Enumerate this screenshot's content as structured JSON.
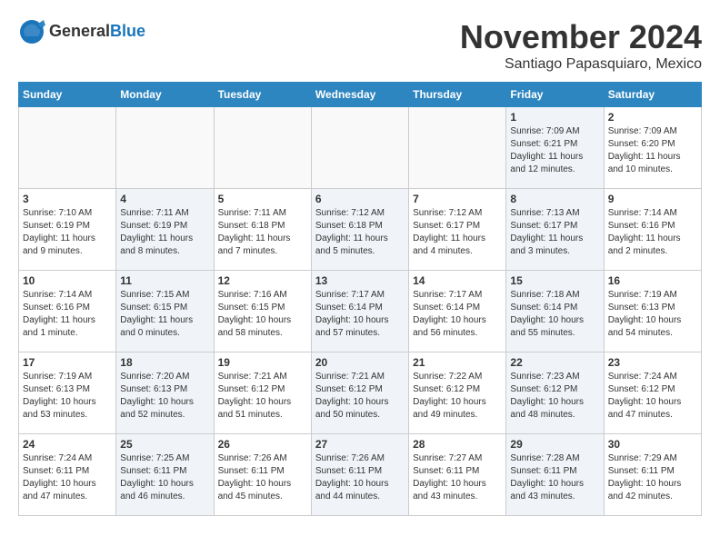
{
  "header": {
    "logo_general": "General",
    "logo_blue": "Blue",
    "month": "November 2024",
    "location": "Santiago Papasquiaro, Mexico"
  },
  "days_of_week": [
    "Sunday",
    "Monday",
    "Tuesday",
    "Wednesday",
    "Thursday",
    "Friday",
    "Saturday"
  ],
  "weeks": [
    [
      {
        "day": "",
        "info": "",
        "shaded": false
      },
      {
        "day": "",
        "info": "",
        "shaded": false
      },
      {
        "day": "",
        "info": "",
        "shaded": false
      },
      {
        "day": "",
        "info": "",
        "shaded": false
      },
      {
        "day": "",
        "info": "",
        "shaded": false
      },
      {
        "day": "1",
        "info": "Sunrise: 7:09 AM\nSunset: 6:21 PM\nDaylight: 11 hours and 12 minutes.",
        "shaded": true
      },
      {
        "day": "2",
        "info": "Sunrise: 7:09 AM\nSunset: 6:20 PM\nDaylight: 11 hours and 10 minutes.",
        "shaded": false
      }
    ],
    [
      {
        "day": "3",
        "info": "Sunrise: 7:10 AM\nSunset: 6:19 PM\nDaylight: 11 hours and 9 minutes.",
        "shaded": false
      },
      {
        "day": "4",
        "info": "Sunrise: 7:11 AM\nSunset: 6:19 PM\nDaylight: 11 hours and 8 minutes.",
        "shaded": true
      },
      {
        "day": "5",
        "info": "Sunrise: 7:11 AM\nSunset: 6:18 PM\nDaylight: 11 hours and 7 minutes.",
        "shaded": false
      },
      {
        "day": "6",
        "info": "Sunrise: 7:12 AM\nSunset: 6:18 PM\nDaylight: 11 hours and 5 minutes.",
        "shaded": true
      },
      {
        "day": "7",
        "info": "Sunrise: 7:12 AM\nSunset: 6:17 PM\nDaylight: 11 hours and 4 minutes.",
        "shaded": false
      },
      {
        "day": "8",
        "info": "Sunrise: 7:13 AM\nSunset: 6:17 PM\nDaylight: 11 hours and 3 minutes.",
        "shaded": true
      },
      {
        "day": "9",
        "info": "Sunrise: 7:14 AM\nSunset: 6:16 PM\nDaylight: 11 hours and 2 minutes.",
        "shaded": false
      }
    ],
    [
      {
        "day": "10",
        "info": "Sunrise: 7:14 AM\nSunset: 6:16 PM\nDaylight: 11 hours and 1 minute.",
        "shaded": false
      },
      {
        "day": "11",
        "info": "Sunrise: 7:15 AM\nSunset: 6:15 PM\nDaylight: 11 hours and 0 minutes.",
        "shaded": true
      },
      {
        "day": "12",
        "info": "Sunrise: 7:16 AM\nSunset: 6:15 PM\nDaylight: 10 hours and 58 minutes.",
        "shaded": false
      },
      {
        "day": "13",
        "info": "Sunrise: 7:17 AM\nSunset: 6:14 PM\nDaylight: 10 hours and 57 minutes.",
        "shaded": true
      },
      {
        "day": "14",
        "info": "Sunrise: 7:17 AM\nSunset: 6:14 PM\nDaylight: 10 hours and 56 minutes.",
        "shaded": false
      },
      {
        "day": "15",
        "info": "Sunrise: 7:18 AM\nSunset: 6:14 PM\nDaylight: 10 hours and 55 minutes.",
        "shaded": true
      },
      {
        "day": "16",
        "info": "Sunrise: 7:19 AM\nSunset: 6:13 PM\nDaylight: 10 hours and 54 minutes.",
        "shaded": false
      }
    ],
    [
      {
        "day": "17",
        "info": "Sunrise: 7:19 AM\nSunset: 6:13 PM\nDaylight: 10 hours and 53 minutes.",
        "shaded": false
      },
      {
        "day": "18",
        "info": "Sunrise: 7:20 AM\nSunset: 6:13 PM\nDaylight: 10 hours and 52 minutes.",
        "shaded": true
      },
      {
        "day": "19",
        "info": "Sunrise: 7:21 AM\nSunset: 6:12 PM\nDaylight: 10 hours and 51 minutes.",
        "shaded": false
      },
      {
        "day": "20",
        "info": "Sunrise: 7:21 AM\nSunset: 6:12 PM\nDaylight: 10 hours and 50 minutes.",
        "shaded": true
      },
      {
        "day": "21",
        "info": "Sunrise: 7:22 AM\nSunset: 6:12 PM\nDaylight: 10 hours and 49 minutes.",
        "shaded": false
      },
      {
        "day": "22",
        "info": "Sunrise: 7:23 AM\nSunset: 6:12 PM\nDaylight: 10 hours and 48 minutes.",
        "shaded": true
      },
      {
        "day": "23",
        "info": "Sunrise: 7:24 AM\nSunset: 6:12 PM\nDaylight: 10 hours and 47 minutes.",
        "shaded": false
      }
    ],
    [
      {
        "day": "24",
        "info": "Sunrise: 7:24 AM\nSunset: 6:11 PM\nDaylight: 10 hours and 47 minutes.",
        "shaded": false
      },
      {
        "day": "25",
        "info": "Sunrise: 7:25 AM\nSunset: 6:11 PM\nDaylight: 10 hours and 46 minutes.",
        "shaded": true
      },
      {
        "day": "26",
        "info": "Sunrise: 7:26 AM\nSunset: 6:11 PM\nDaylight: 10 hours and 45 minutes.",
        "shaded": false
      },
      {
        "day": "27",
        "info": "Sunrise: 7:26 AM\nSunset: 6:11 PM\nDaylight: 10 hours and 44 minutes.",
        "shaded": true
      },
      {
        "day": "28",
        "info": "Sunrise: 7:27 AM\nSunset: 6:11 PM\nDaylight: 10 hours and 43 minutes.",
        "shaded": false
      },
      {
        "day": "29",
        "info": "Sunrise: 7:28 AM\nSunset: 6:11 PM\nDaylight: 10 hours and 43 minutes.",
        "shaded": true
      },
      {
        "day": "30",
        "info": "Sunrise: 7:29 AM\nSunset: 6:11 PM\nDaylight: 10 hours and 42 minutes.",
        "shaded": false
      }
    ]
  ]
}
